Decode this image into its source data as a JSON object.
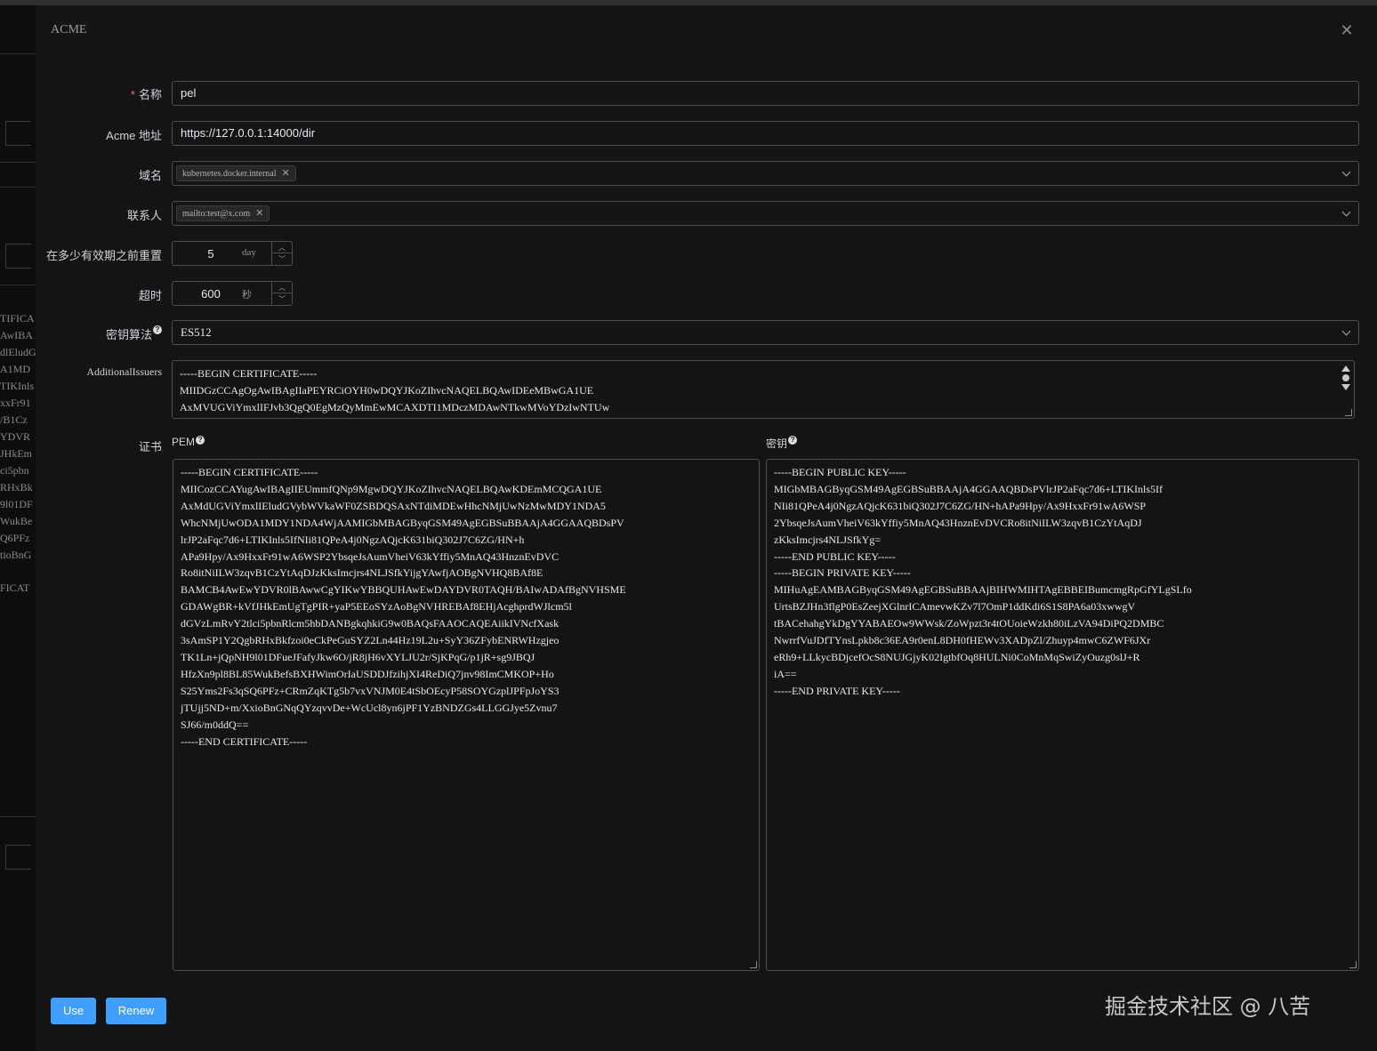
{
  "dialog": {
    "title": "ACME",
    "close_icon": "close-icon"
  },
  "background_fragments": [
    "TIFICA",
    "AwIBA",
    "dlEludG",
    "A1MD",
    "TIKInls",
    "xxFr91",
    "/B1Cz",
    "YDVR",
    "JHkEm",
    "ci5pbn",
    "RHxBk",
    "9l01DF",
    "WukBe",
    "Q6PFz",
    "tioBnG",
    "FICAT"
  ],
  "form": {
    "name": {
      "label": "名称",
      "required_mark": "*",
      "value": "pel"
    },
    "acme_url": {
      "label": "Acme 地址",
      "value": "https://127.0.0.1:14000/dir"
    },
    "domains": {
      "label": "域名",
      "tags": [
        "kubernetes.docker.internal"
      ]
    },
    "contacts": {
      "label": "联系人",
      "tags": [
        "mailto:test@x.com"
      ]
    },
    "renew_before": {
      "label": "在多少有效期之前重置",
      "value": "5",
      "unit": "day"
    },
    "timeout": {
      "label": "超时",
      "value": "600",
      "unit": "秒"
    },
    "key_algorithm": {
      "label": "密钥算法",
      "value": "ES512"
    },
    "additional_issuers": {
      "label": "AdditionalIssuers",
      "lines": [
        "-----BEGIN CERTIFICATE-----",
        "MIIDGzCCAgOgAwIBAgIIaPEYRCiOYH0wDQYJKoZIhvcNAQELBQAwIDEeMBwGA1UE",
        "AxMVUGViYmxlIFJvb3QgQ0EgMzQyMmEwMCAXDTI1MDczMDAwNTkwMVoYDzIwNTUw"
      ]
    },
    "certificate": {
      "label": "证书",
      "pem_label": "PEM",
      "pem_lines": [
        "-----BEGIN CERTIFICATE-----",
        "MIICozCCAYugAwIBAgIIEUmmfQNp9MgwDQYJKoZIhvcNAQELBQAwKDEmMCQGA1UE",
        "AxMdUGViYmxlIEludGVybWVkaWF0ZSBDQSAxNTdiMDEwHhcNMjUwNzMwMDY1NDA5",
        "WhcNMjUwODA1MDY1NDA4WjAAMIGbMBAGByqGSM49AgEGBSuBBAAjA4GGAAQBDsPV",
        "lrJP2aFqc7d6+LTIKInls5IfNIi81QPeA4j0NgzAQjcK631biQ302J7C6ZG/HN+h",
        "APa9Hpy/Ax9HxxFr91wA6WSP2YbsqeJsAumVheiV63kYffiy5MnAQ43HnznEvDVC",
        "Ro8itNiILW3zqvB1CzYtAqDJzKksImcjrs4NLJSfkYijgYAwfjAOBgNVHQ8BAf8E",
        "BAMCB4AwEwYDVR0lBAwwCgYIKwYBBQUHAwEwDAYDVR0TAQH/BAIwADAfBgNVHSME",
        "GDAWgBR+kVfJHkEmUgTgPIR+yaP5EEoSYzAoBgNVHREBAf8EHjAcghprdWJlcm5l",
        "dGVzLmRvY2tlci5pbnRlcm5hbDANBgkqhkiG9w0BAQsFAAOCAQEAiikIVNcfXask",
        "3sAmSP1Y2QgbRHxBkfzoi0eCkPeGuSYZ2Ln44Hz19L2u+SyY36ZFybENRWHzgjeo",
        "TK1Ln+jQpNH9l01DFueJFafyJkw6O/jR8jH6vXYLJU2r/SjKPqG/p1jR+sg9JBQJ",
        "HfzXn9pl8BL85WukBefsBXHWimOrIaUSDDJfzihjXI4ReDiQ7jnv98ImCMKOP+Ho",
        "S25Yms2Fs3qSQ6PFz+CRmZqKTg5b7vxVNJM0E4tSbOEcyP58SOYGzplJPFpJoYS3",
        "jTUjj5ND+m/XxioBnGNqQYzqvvDe+WcUcl8yn6jPF1YzBNDZGs4LLGGJye5Zvnu7",
        "SJ66/m0ddQ==",
        "-----END CERTIFICATE-----"
      ],
      "key_label": "密钥",
      "key_lines": [
        "-----BEGIN PUBLIC KEY-----",
        "MIGbMBAGByqGSM49AgEGBSuBBAAjA4GGAAQBDsPVlrJP2aFqc7d6+LTIKInls5If",
        "NIi81QPeA4j0NgzAQjcK631biQ302J7C6ZG/HN+hAPa9Hpy/Ax9HxxFr91wA6WSP",
        "2YbsqeJsAumVheiV63kYffiy5MnAQ43HnznEvDVCRo8itNiILW3zqvB1CzYtAqDJ",
        "zKksImcjrs4NLJSfkYg=",
        "-----END PUBLIC KEY-----",
        "-----BEGIN PRIVATE KEY-----",
        "MIHuAgEAMBAGByqGSM49AgEGBSuBBAAjBIHWMIHTAgEBBEIBumcmgRpGfYLgSLfo",
        "UrtsBZJHn3flgP0EsZeejXGlnrICAmevwKZv7l7OmP1ddKdi6S1S8PA6a03xwwgV",
        "tBACehahgYkDgYYABAEOw9WWsk/ZoWpzt3r4tOUoieWzkh80iLzVA94DiPQ2DMBC",
        "NwrrfVuJDfTYnsLpkb8c36EA9r0enL8DH0fHEWv3XADpZl/Zhuyp4mwC6ZWF6JXr",
        "eRh9+LLkycBDjcefOcS8NUJGjyK02IgtbfOq8HULNi0CoMnMqSwiZyOuzg0slJ+R",
        "iA==",
        "-----END PRIVATE KEY-----"
      ]
    }
  },
  "buttons": {
    "use": "Use",
    "renew": "Renew"
  },
  "watermark": "掘金技术社区 @ 八苦",
  "colors": {
    "primary": "#409eff",
    "required": "#f56c6c",
    "background": "#141414"
  }
}
